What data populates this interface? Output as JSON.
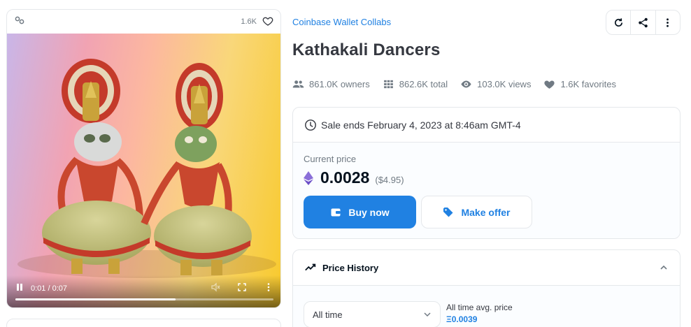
{
  "media": {
    "favorites_count": "1.6K",
    "video": {
      "time_display": "0:01 / 0:07",
      "progress": 0.62
    }
  },
  "item": {
    "collection": "Coinbase Wallet Collabs",
    "title": "Kathakali Dancers"
  },
  "stats": {
    "owners": "861.0K owners",
    "total": "862.6K total",
    "views": "103.0K views",
    "favorites": "1.6K favorites"
  },
  "sale": {
    "ends_text": "Sale ends February 4, 2023 at 8:46am GMT-4",
    "price_label": "Current price",
    "price_value": "0.0028",
    "price_usd": "($4.95)",
    "buy_label": "Buy now",
    "offer_label": "Make offer"
  },
  "price_history": {
    "title": "Price History",
    "range_selected": "All time",
    "avg_label": "All time avg. price",
    "avg_value": "Ξ0.0039"
  },
  "colors": {
    "accent": "#2081e2",
    "text_primary": "#04111d",
    "text_secondary": "#707a83",
    "border": "#e5e8eb"
  },
  "icons": {
    "chain": "chain-link-icon",
    "heart": "heart-icon",
    "refresh": "refresh-icon",
    "share": "share-icon",
    "more": "more-vertical-icon",
    "owners": "people-icon",
    "total": "grid-icon",
    "views": "eye-icon",
    "favorites": "heart-filled-icon",
    "clock": "clock-icon",
    "eth": "ethereum-icon",
    "wallet": "wallet-icon",
    "tag": "tag-icon",
    "trend": "trending-icon",
    "chevron": "chevron-up-icon"
  }
}
